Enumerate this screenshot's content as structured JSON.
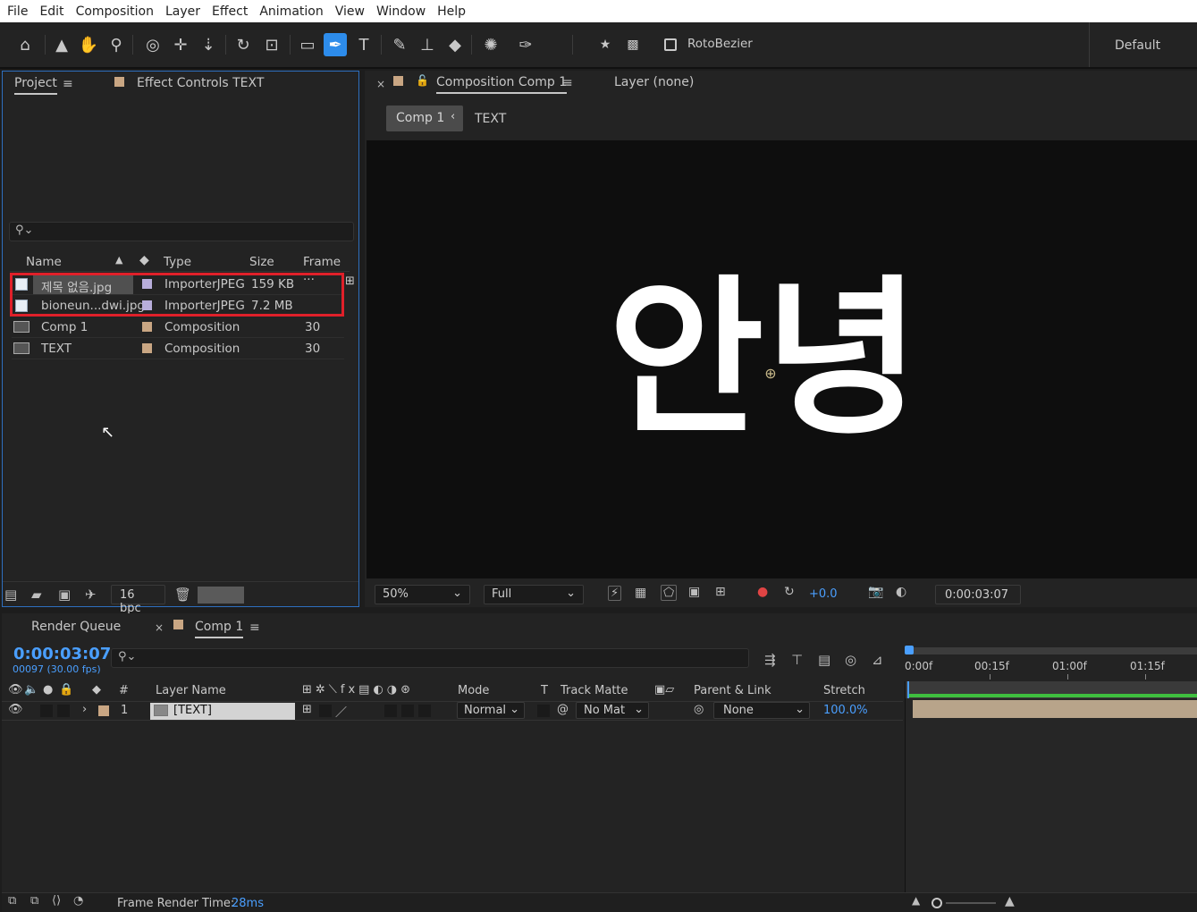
{
  "menu": [
    "File",
    "Edit",
    "Composition",
    "Layer",
    "Effect",
    "Animation",
    "View",
    "Window",
    "Help"
  ],
  "toolbar": {
    "rotobezier_label": "RotoBezier",
    "workspace_label": "Default"
  },
  "project_panel": {
    "tab_project": "Project",
    "tab_effect_controls": "Effect Controls TEXT",
    "search_placeholder": "",
    "columns": {
      "name": "Name",
      "type": "Type",
      "size": "Size",
      "frame": "Frame ..."
    },
    "items": [
      {
        "name": "제목 없음.jpg",
        "type": "ImporterJPEG",
        "size": "159 KB",
        "frame": ""
      },
      {
        "name": "bioneun...dwi.jpg",
        "type": "ImporterJPEG",
        "size": "7.2 MB",
        "frame": ""
      },
      {
        "name": "Comp 1",
        "type": "Composition",
        "size": "",
        "frame": "30"
      },
      {
        "name": "TEXT",
        "type": "Composition",
        "size": "",
        "frame": "30"
      }
    ],
    "bpc_label": "16 bpc"
  },
  "comp_panel": {
    "tab_composition": "Composition Comp 1",
    "tab_layer": "Layer (none)",
    "breadcrumb_comp": "Comp 1",
    "breadcrumb_text": "TEXT",
    "viewer_text_line1": "안녕",
    "zoom": "50%",
    "resolution": "Full",
    "exposure": "+0.0",
    "timecode": "0:00:03:07"
  },
  "timeline": {
    "tab_render_queue": "Render Queue",
    "tab_comp": "Comp 1",
    "current_time": "0:00:03:07",
    "frame_info": "00097 (30.00 fps)",
    "ruler": [
      "0:00f",
      "00:15f",
      "01:00f",
      "01:15f"
    ],
    "columns": {
      "num": "#",
      "layer_name": "Layer Name",
      "mode": "Mode",
      "t": "T",
      "track_matte": "Track Matte",
      "parent": "Parent & Link",
      "stretch": "Stretch"
    },
    "layers": [
      {
        "num": "1",
        "name": "[TEXT]",
        "mode": "Normal",
        "matte": "No Mat",
        "parent": "None",
        "stretch": "100.0%"
      }
    ],
    "frame_render_label": "Frame Render Time:",
    "frame_render_value": "28ms"
  },
  "colors": {
    "accent_blue": "#2d8ceb",
    "time_blue": "#4a9fff",
    "highlight_red": "#e0202a",
    "label_tan": "#c9a683",
    "label_lavender": "#b8aedb"
  }
}
